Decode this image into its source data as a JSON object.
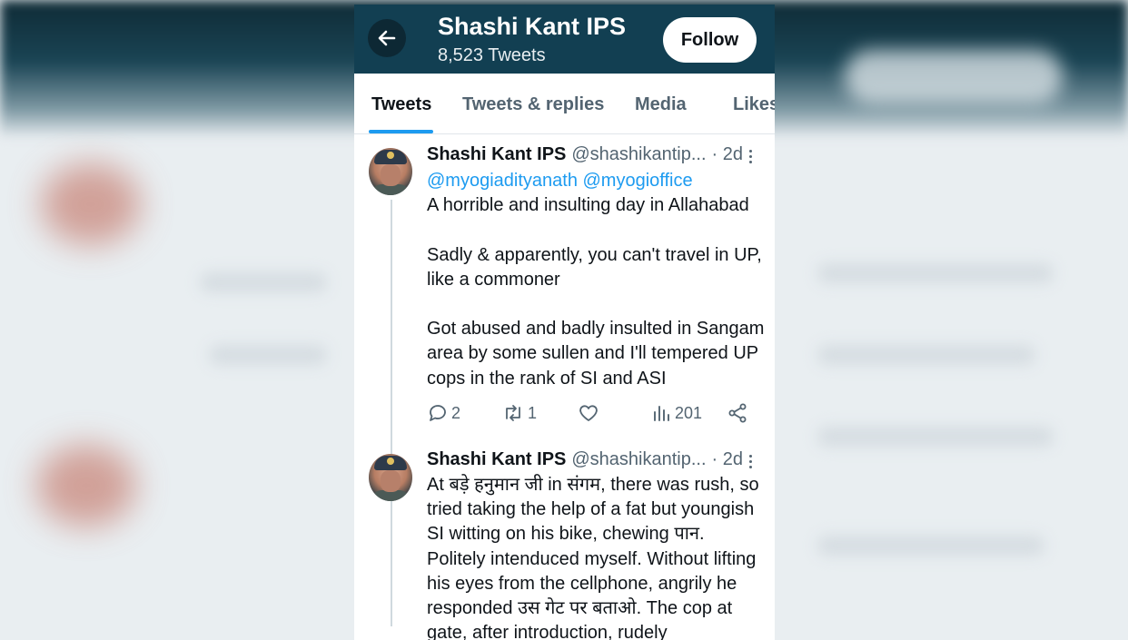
{
  "profile": {
    "name": "Shashi Kant IPS",
    "tweet_count": "8,523 Tweets",
    "follow_label": "Follow"
  },
  "tabs": [
    {
      "label": "Tweets",
      "active": true
    },
    {
      "label": "Tweets & replies",
      "active": false
    },
    {
      "label": "Media",
      "active": false
    },
    {
      "label": "Likes",
      "active": false
    }
  ],
  "tweets": [
    {
      "author": "Shashi Kant IPS",
      "handle": "@shashikantip...",
      "time": "· 2d",
      "mentions": "@myogiadityanath @myogioffice",
      "lines": [
        "A horrible and insulting day in Allahabad",
        "",
        "Sadly & apparently, you can't travel in UP,",
        "like a commoner",
        "",
        "Got abused and badly insulted in Sangam",
        "area by some sullen and I'll tempered UP",
        "cops in the rank of SI and ASI"
      ],
      "replies": "2",
      "retweets": "1",
      "views": "201"
    },
    {
      "author": "Shashi Kant IPS",
      "handle": "@shashikantip...",
      "time": "· 2d",
      "lines": [
        "At बड़े हनुमान जी in संगम, there was rush, so",
        "tried taking the help of a fat but youngish",
        "SI witting on his bike, chewing पान.",
        "Politely intenduced myself. Without lifting",
        "his eyes from the cellphone, angrily he",
        "responded उस गेट पर बताओ. The cop at",
        "gate, after introduction, rudely"
      ]
    }
  ],
  "colors": {
    "header_bg": "#123f52",
    "accent": "#1d9bf0",
    "text_primary": "#0f1419",
    "text_secondary": "#536471"
  },
  "icons": [
    "back-arrow-icon",
    "more-options-icon",
    "reply-icon",
    "retweet-icon",
    "like-icon",
    "views-icon",
    "share-icon"
  ]
}
